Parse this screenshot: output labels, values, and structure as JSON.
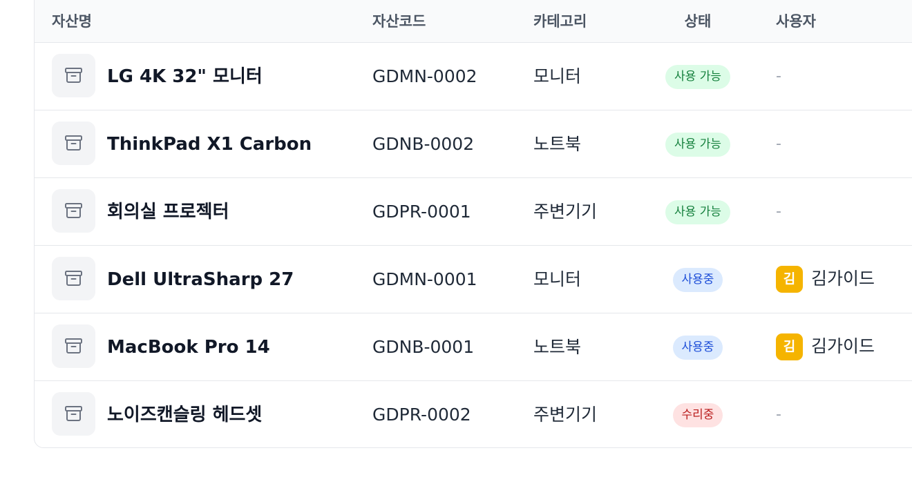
{
  "table": {
    "columns": {
      "name": "자산명",
      "code": "자산코드",
      "category": "카테고리",
      "status": "상태",
      "user": "사용자"
    },
    "rows": [
      {
        "name": "LG 4K 32\" 모니터",
        "code": "GDMN-0002",
        "category": "모니터",
        "status": "사용 가능",
        "status_kind": "available",
        "user": null,
        "user_initial": null,
        "empty": "-",
        "icon": "archive-box-icon"
      },
      {
        "name": "ThinkPad X1 Carbon",
        "code": "GDNB-0002",
        "category": "노트북",
        "status": "사용 가능",
        "status_kind": "available",
        "user": null,
        "user_initial": null,
        "empty": "-",
        "icon": "archive-box-icon"
      },
      {
        "name": "회의실 프로젝터",
        "code": "GDPR-0001",
        "category": "주변기기",
        "status": "사용 가능",
        "status_kind": "available",
        "user": null,
        "user_initial": null,
        "empty": "-",
        "icon": "archive-box-icon"
      },
      {
        "name": "Dell UltraSharp 27",
        "code": "GDMN-0001",
        "category": "모니터",
        "status": "사용중",
        "status_kind": "in-use",
        "user": "김가이드",
        "user_initial": "김",
        "empty": "",
        "icon": "archive-box-icon"
      },
      {
        "name": "MacBook Pro 14",
        "code": "GDNB-0001",
        "category": "노트북",
        "status": "사용중",
        "status_kind": "in-use",
        "user": "김가이드",
        "user_initial": "김",
        "empty": "",
        "icon": "archive-box-icon"
      },
      {
        "name": "노이즈캔슬링 헤드셋",
        "code": "GDPR-0002",
        "category": "주변기기",
        "status": "수리중",
        "status_kind": "repair",
        "user": null,
        "user_initial": null,
        "empty": "-",
        "icon": "archive-box-icon"
      }
    ]
  },
  "colors": {
    "available_bg": "#dcfce7",
    "available_text": "#15803d",
    "in_use_bg": "#dbeafe",
    "in_use_text": "#1d4ed8",
    "repair_bg": "#fee2e2",
    "repair_text": "#b91c1c",
    "avatar_bg": "#f5b400"
  }
}
